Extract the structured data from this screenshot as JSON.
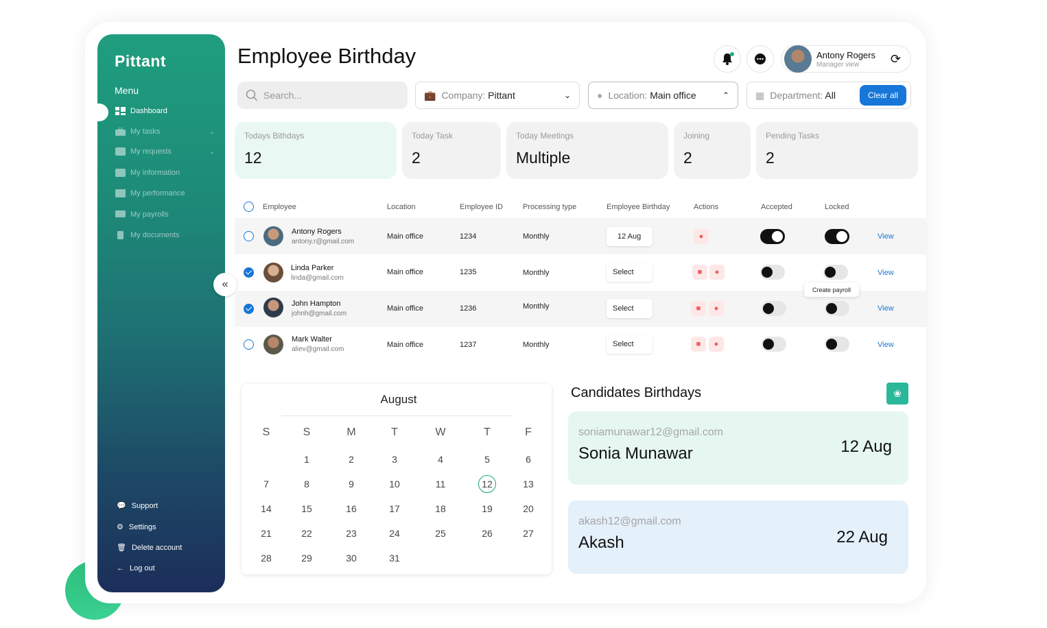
{
  "sidebar": {
    "logo": "Pittant",
    "menu_title": "Menu",
    "items": [
      {
        "label": "Dashboard"
      },
      {
        "label": "My tasks"
      },
      {
        "label": "My requests"
      },
      {
        "label": "My information"
      },
      {
        "label": "My performance"
      },
      {
        "label": "My payrolls"
      },
      {
        "label": "My documents"
      }
    ],
    "bottom": [
      {
        "label": "Support"
      },
      {
        "label": "Settings"
      },
      {
        "label": "Delete account"
      },
      {
        "label": "Log out"
      }
    ]
  },
  "header": {
    "title": "Employee Birthday",
    "user_name": "Antony Rogers",
    "user_role": "Manager view"
  },
  "filters": {
    "search_placeholder": "Search...",
    "company_label": "Company:",
    "company_value": "Pittant",
    "location_label": "Location:",
    "location_value": "Main office",
    "department_label": "Department:",
    "department_value": "All",
    "clear_label": "Clear all"
  },
  "stats": [
    {
      "label": "Todays Bithdays",
      "value": "12"
    },
    {
      "label": "Today Task",
      "value": "2"
    },
    {
      "label": "Today Meetings",
      "value": "Multiple"
    },
    {
      "label": "Joining",
      "value": "2"
    },
    {
      "label": "Pending Tasks",
      "value": "2"
    }
  ],
  "table": {
    "headers": [
      "Employee",
      "Location",
      "Employee ID",
      "Processing type",
      "Employee Birthday",
      "Actions",
      "Accepted",
      "Locked"
    ],
    "rows": [
      {
        "name": "Antony Rogers",
        "email": "antony.r@gmail.com",
        "location": "Main office",
        "id": "1234",
        "type": "Monthly",
        "birthday": "12 Aug",
        "view": "View",
        "accepted": true,
        "locked": true,
        "checked": false
      },
      {
        "name": "Linda Parker",
        "email": "linda@gmail.com",
        "location": "Main office",
        "id": "1235",
        "type": "Monthly",
        "birthday": "Select",
        "view": "View",
        "accepted": false,
        "locked": false,
        "checked": true
      },
      {
        "name": "John Hampton",
        "email": "johnh@gmail.com",
        "location": "Main office",
        "id": "1236",
        "type": "Monthly",
        "birthday": "Select",
        "view": "View",
        "accepted": false,
        "locked": false,
        "checked": true
      },
      {
        "name": "Mark Walter",
        "email": "aliev@gmail.com",
        "location": "Main office",
        "id": "1237",
        "type": "Monthly",
        "birthday": "Select",
        "view": "View",
        "accepted": false,
        "locked": false,
        "checked": false
      }
    ],
    "tooltip": "Create payroll"
  },
  "calendar": {
    "month": "August",
    "weekdays": [
      "S",
      "S",
      "M",
      "T",
      "W",
      "T",
      "F"
    ],
    "weeks": [
      [
        "",
        "1",
        "2",
        "3",
        "4",
        "5",
        "6"
      ],
      [
        "7",
        "8",
        "9",
        "10",
        "11",
        "12",
        "13"
      ],
      [
        "14",
        "15",
        "16",
        "17",
        "18",
        "19",
        "20"
      ],
      [
        "21",
        "22",
        "23",
        "24",
        "25",
        "26",
        "27"
      ],
      [
        "28",
        "29",
        "30",
        "31",
        "",
        "",
        ""
      ]
    ],
    "selected": "12"
  },
  "candidates": {
    "title": "Candidates Birthdays",
    "items": [
      {
        "email": "soniamunawar12@gmail.com",
        "name": "Sonia Munawar",
        "date": "12 Aug",
        "color": "#e6f7f1"
      },
      {
        "email": "akash12@gmail.com",
        "name": "Akash",
        "date": "22 Aug",
        "color": "#e4f0fa"
      }
    ]
  },
  "colors": {
    "accent": "#1677d8",
    "brand": "#1f9e7e",
    "danger": "#ef5b5b"
  }
}
